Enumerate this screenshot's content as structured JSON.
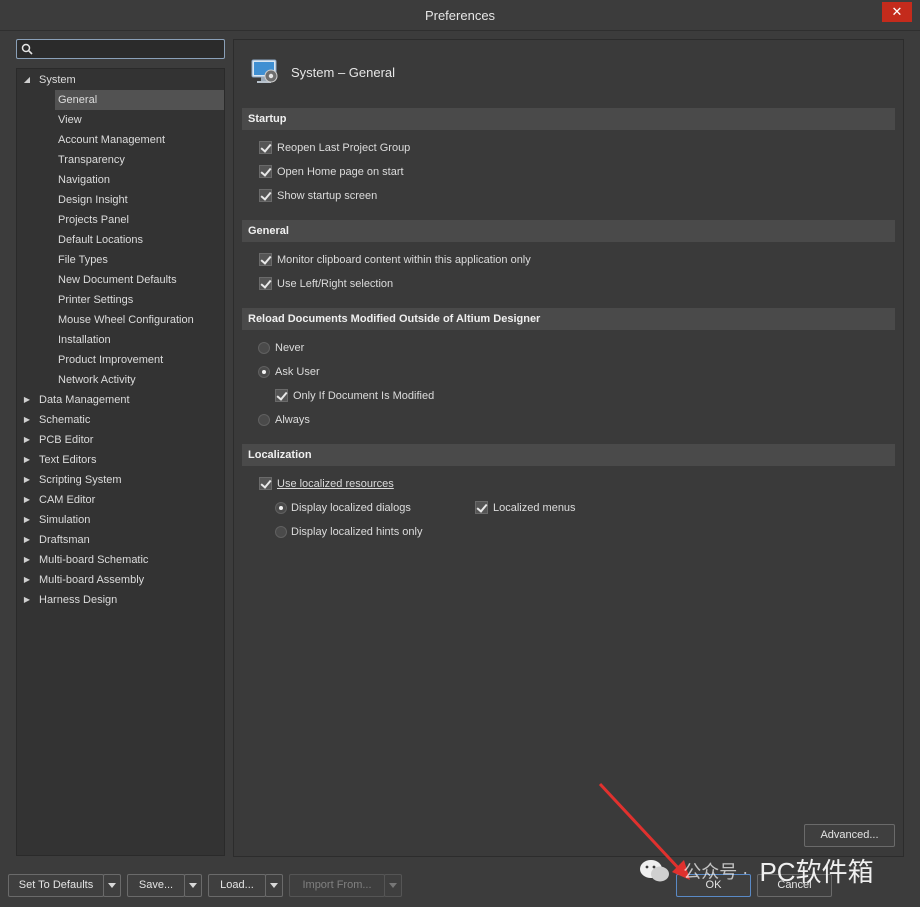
{
  "window": {
    "title": "Preferences",
    "close_glyph": "✕"
  },
  "search": {
    "value": "",
    "placeholder": ""
  },
  "tree": {
    "items": [
      {
        "label": "System",
        "expanded": true,
        "level": 0
      },
      {
        "label": "General",
        "level": 1,
        "selected": true
      },
      {
        "label": "View",
        "level": 1
      },
      {
        "label": "Account Management",
        "level": 1
      },
      {
        "label": "Transparency",
        "level": 1
      },
      {
        "label": "Navigation",
        "level": 1
      },
      {
        "label": "Design Insight",
        "level": 1
      },
      {
        "label": "Projects Panel",
        "level": 1
      },
      {
        "label": "Default Locations",
        "level": 1
      },
      {
        "label": "File Types",
        "level": 1
      },
      {
        "label": "New Document Defaults",
        "level": 1
      },
      {
        "label": "Printer Settings",
        "level": 1
      },
      {
        "label": "Mouse Wheel Configuration",
        "level": 1
      },
      {
        "label": "Installation",
        "level": 1
      },
      {
        "label": "Product Improvement",
        "level": 1
      },
      {
        "label": "Network Activity",
        "level": 1
      },
      {
        "label": "Data Management",
        "level": 0
      },
      {
        "label": "Schematic",
        "level": 0
      },
      {
        "label": "PCB Editor",
        "level": 0
      },
      {
        "label": "Text Editors",
        "level": 0
      },
      {
        "label": "Scripting System",
        "level": 0
      },
      {
        "label": "CAM Editor",
        "level": 0
      },
      {
        "label": "Simulation",
        "level": 0
      },
      {
        "label": "Draftsman",
        "level": 0
      },
      {
        "label": "Multi-board Schematic",
        "level": 0
      },
      {
        "label": "Multi-board Assembly",
        "level": 0
      },
      {
        "label": "Harness Design",
        "level": 0
      }
    ]
  },
  "page": {
    "title": "System – General",
    "icon": "monitor-settings-icon",
    "sections": {
      "startup": {
        "title": "Startup",
        "options": [
          {
            "label": "Reopen Last Project Group",
            "checked": true
          },
          {
            "label": "Open Home page on start",
            "checked": true
          },
          {
            "label": "Show startup screen",
            "checked": true
          }
        ]
      },
      "general": {
        "title": "General",
        "options": [
          {
            "label": "Monitor clipboard content within this application only",
            "checked": true
          },
          {
            "label": "Use Left/Right selection",
            "checked": true
          }
        ]
      },
      "reload": {
        "title": "Reload Documents Modified Outside of Altium Designer",
        "never": "Never",
        "ask_user": "Ask User",
        "only_if_modified": "Only If Document Is Modified",
        "always": "Always",
        "selected": "Ask User",
        "only_if_modified_checked": true
      },
      "localization": {
        "title": "Localization",
        "use_localized": "Use localized resources",
        "use_localized_checked": true,
        "display_dialogs": "Display localized dialogs",
        "display_hints": "Display localized hints only",
        "selected": "Display localized dialogs",
        "localized_menus": "Localized menus",
        "localized_menus_checked": true
      }
    },
    "advanced_button": "Advanced..."
  },
  "footer": {
    "set_to_defaults": "Set To Defaults",
    "save": "Save...",
    "load": "Load...",
    "import_from": "Import From...",
    "ok": "OK",
    "cancel": "Cancel"
  },
  "watermark": {
    "prefix": "公众号 ·",
    "text": "PC软件箱"
  },
  "colors": {
    "close": "#c42b1c",
    "selection": "#525252",
    "section_header": "#4a4a4a",
    "annotation_arrow": "#e0312e"
  }
}
